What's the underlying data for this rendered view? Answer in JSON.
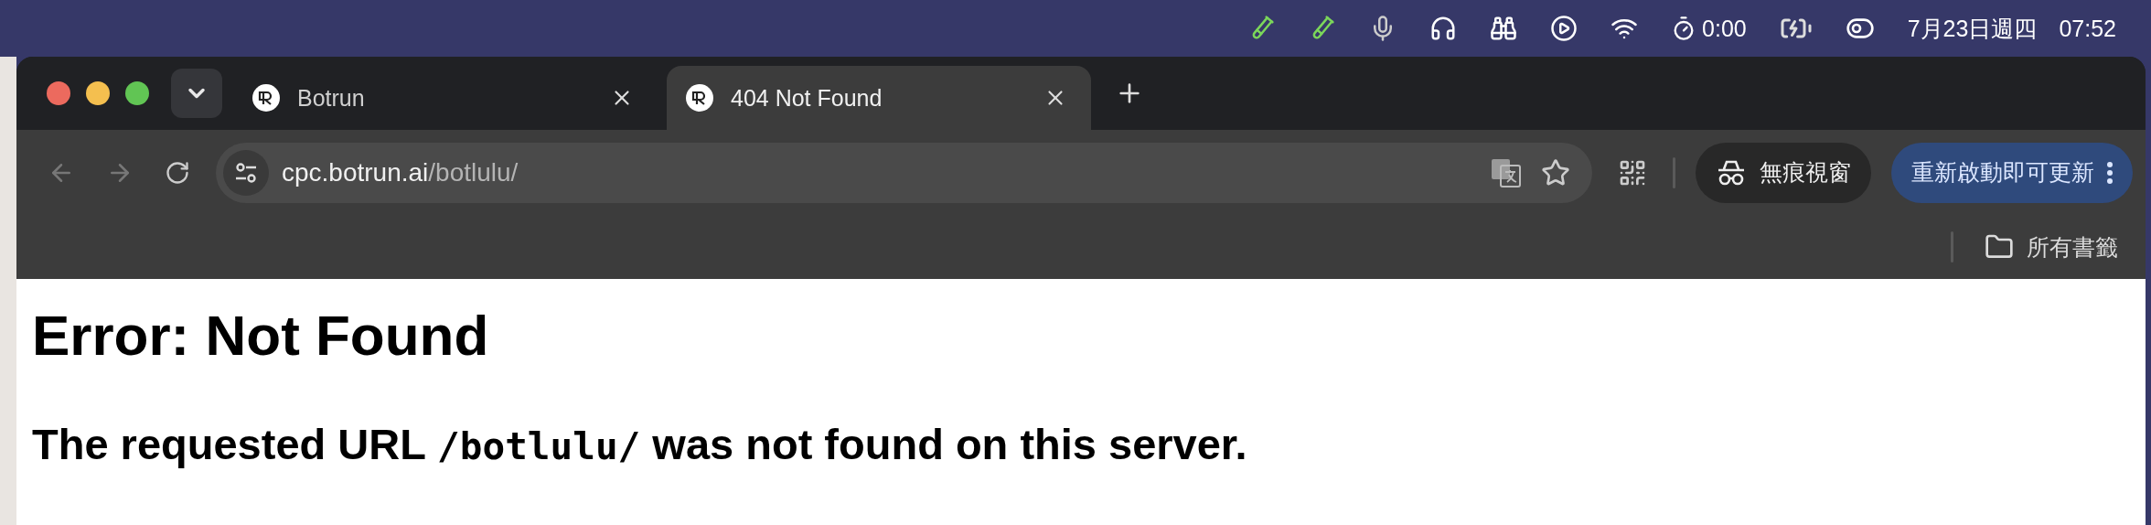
{
  "menu_bar": {
    "timer": "0:00",
    "date": "7月23日週四",
    "time": "07:52"
  },
  "tabs": [
    {
      "title": "Botrun",
      "selected": false
    },
    {
      "title": "404 Not Found",
      "selected": true
    }
  ],
  "address_bar": {
    "host": "cpc.botrun.ai",
    "path": "/botlulu/"
  },
  "toolbar": {
    "incognito": "無痕視窗",
    "update": "重新啟動即可更新"
  },
  "bookmarks_bar": {
    "all_bookmarks": "所有書籤"
  },
  "page": {
    "heading": "Error: Not Found",
    "message": {
      "before": "The requested URL ",
      "code": "/botlulu/",
      "after": " was not found on this server."
    }
  }
}
